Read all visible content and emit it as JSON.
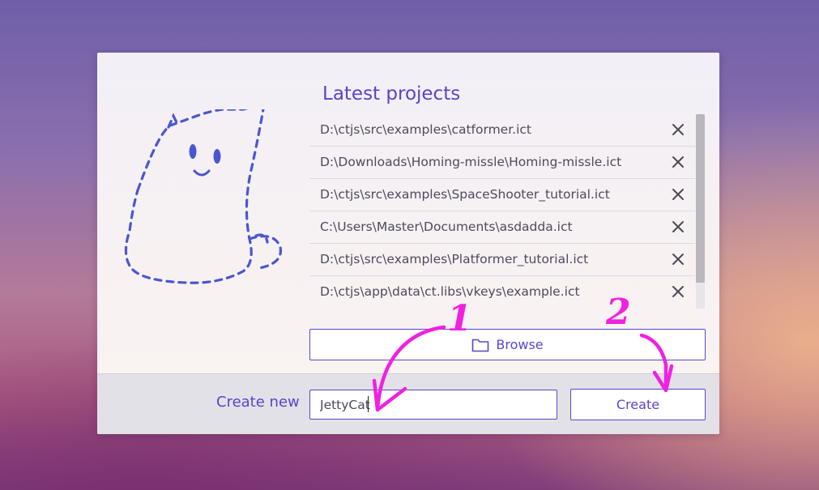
{
  "dialog": {
    "title": "Latest projects",
    "projects": [
      {
        "path": "D:\\ctjs\\src\\examples\\catformer.ict"
      },
      {
        "path": "D:\\Downloads\\Homing-missle\\Homing-missle.ict"
      },
      {
        "path": "D:\\ctjs\\src\\examples\\SpaceShooter_tutorial.ict"
      },
      {
        "path": "C:\\Users\\Master\\Documents\\asdadda.ict"
      },
      {
        "path": "D:\\ctjs\\src\\examples\\Platformer_tutorial.ict"
      },
      {
        "path": "D:\\ctjs\\app\\data\\ct.libs\\vkeys\\example.ict"
      }
    ],
    "browse_label": "Browse",
    "create_new_label": "Create new",
    "project_name_value": "JettyCat",
    "create_label": "Create"
  },
  "annotations": {
    "step_1": "1",
    "step_2": "2"
  },
  "colors": {
    "accent": "#5a47c6",
    "annotation": "#f021e0",
    "cat_outline": "#4a56d2"
  },
  "icons": {
    "remove": "close-icon",
    "browse": "folder-icon"
  }
}
